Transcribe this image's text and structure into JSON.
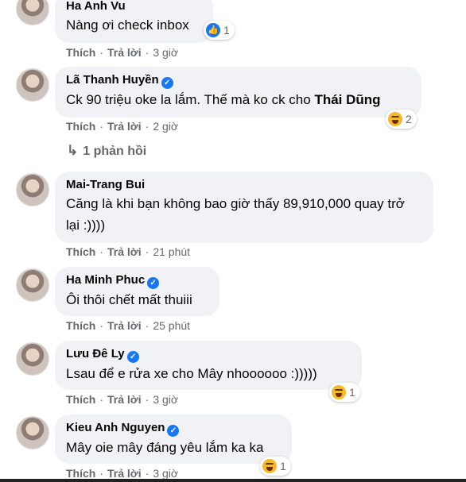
{
  "actions": {
    "like": "Thích",
    "reply": "Trả lời"
  },
  "comments": [
    {
      "name": "Ha Anh Vu",
      "verified": false,
      "lines": [
        "Nàng ơi check inbox"
      ],
      "time": "3 giờ",
      "reaction": {
        "type": "like",
        "count": "1"
      }
    },
    {
      "name": "Lã Thanh Huyền",
      "verified": true,
      "lines": [
        "Ck 90 triệu oke la lắm. Thế mà ko ck cho "
      ],
      "mention": "Thái Dũng",
      "time": "2 giờ",
      "reaction": {
        "type": "haha",
        "count": "2"
      }
    },
    {
      "name": "Mai-Trang Bui",
      "verified": false,
      "lines": [
        "Căng là khi bạn không bao giờ thấy 89,910,000 quay trở",
        "lại :))))"
      ],
      "time": "21 phút"
    },
    {
      "name": "Ha Minh Phuc",
      "verified": true,
      "lines": [
        "Ôi thôi chết mất thuiii"
      ],
      "time": "25 phút"
    },
    {
      "name": "Lưu Đê Ly",
      "verified": true,
      "lines": [
        "Lsau để e rửa xe cho Mây nhoooooo :)))))"
      ],
      "time": "3 giờ",
      "reaction": {
        "type": "haha",
        "count": "1"
      }
    },
    {
      "name": "Kieu Anh Nguyen",
      "verified": true,
      "lines": [
        "Mây oie mây đáng yêu lắm ka ka"
      ],
      "time": "3 giờ",
      "reaction": {
        "type": "haha",
        "count": "1"
      }
    }
  ],
  "replies_link": "1 phản hồi",
  "icons": {
    "reply_arrow": "reply-arrow-icon",
    "verified": "verified-badge-icon",
    "like": "like-icon",
    "haha": "haha-icon"
  },
  "colors": {
    "bubble": "#f0f2f5",
    "meta": "#65676b",
    "verified": "#1877f2",
    "haha": "#f7b928"
  }
}
